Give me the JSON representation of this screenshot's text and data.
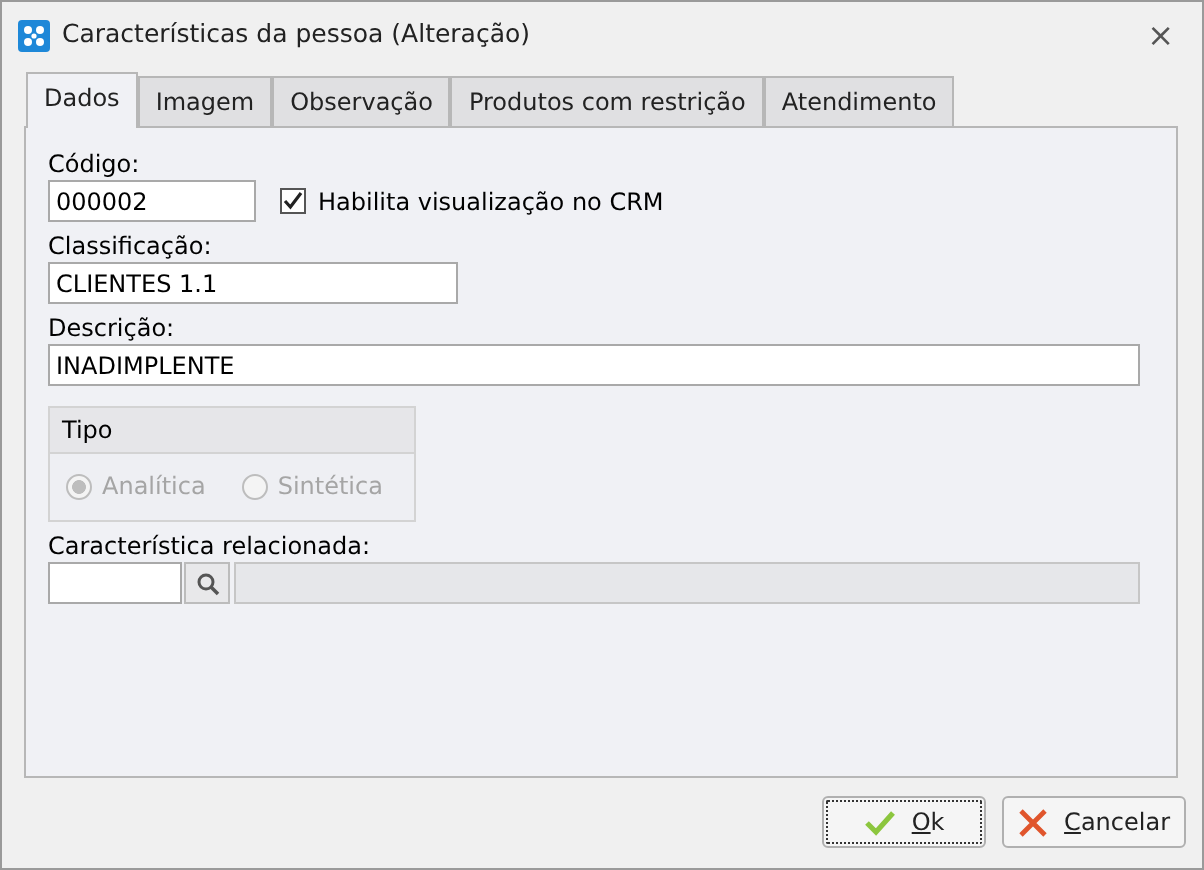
{
  "window": {
    "title": "Características da pessoa (Alteração)",
    "close": "×"
  },
  "tabs": [
    {
      "label": "Dados",
      "selected": true
    },
    {
      "label": "Imagem",
      "selected": false
    },
    {
      "label": "Observação",
      "selected": false
    },
    {
      "label": "Produtos com restrição",
      "selected": false
    },
    {
      "label": "Atendimento",
      "selected": false
    }
  ],
  "codigo": {
    "label": "Código:",
    "value": "000002"
  },
  "crm": {
    "label": "Habilita visualização no CRM",
    "checked": true
  },
  "classificacao": {
    "label": "Classificação:",
    "value": "CLIENTES 1.1"
  },
  "descricao": {
    "label": "Descrição:",
    "value": "INADIMPLENTE"
  },
  "tipo": {
    "title": "Tipo",
    "disabled": true,
    "options": [
      {
        "label": "Analítica",
        "selected": true
      },
      {
        "label": "Sintética",
        "selected": false
      }
    ]
  },
  "relacionada": {
    "label": "Característica relacionada:"
  },
  "buttons": [
    {
      "label": "Ok",
      "kind": "ok",
      "focused": true
    },
    {
      "label": "Cancelar",
      "kind": "cancel",
      "focused": false
    }
  ]
}
